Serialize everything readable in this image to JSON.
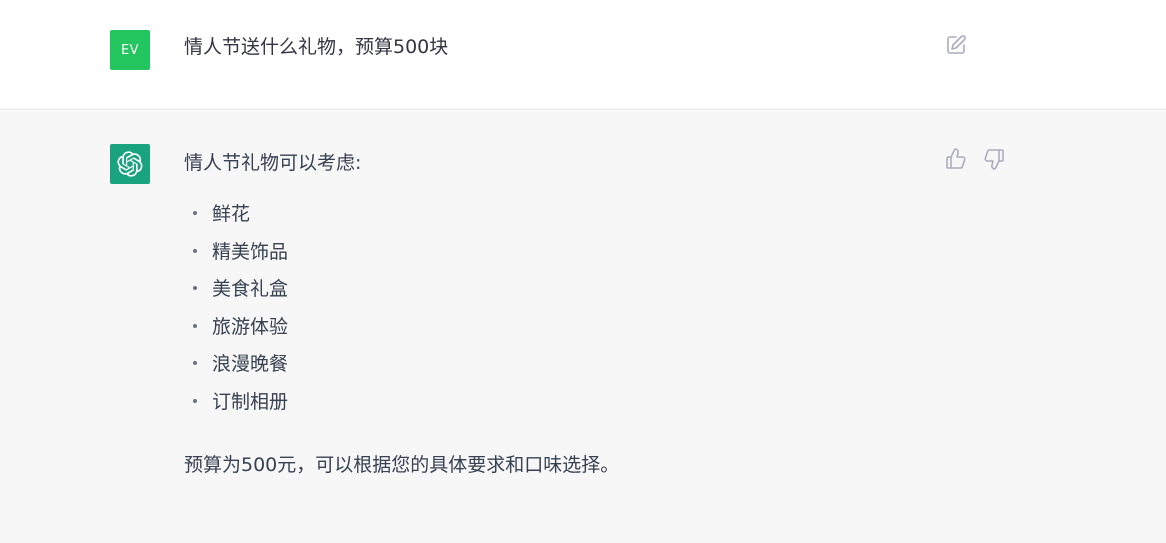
{
  "user_message": {
    "avatar_initials": "EV",
    "avatar_color": "#22c55e",
    "text": "情人节送什么礼物，预算500块",
    "edit_icon": "edit-icon"
  },
  "assistant_message": {
    "avatar_color": "#19a37f",
    "avatar_icon": "openai-logo-icon",
    "intro": "情人节礼物可以考虑:",
    "items": [
      {
        "label": "鲜花"
      },
      {
        "label": "精美饰品"
      },
      {
        "label": "美食礼盒"
      },
      {
        "label": "旅游体验"
      },
      {
        "label": "浪漫晚餐"
      },
      {
        "label": "订制相册"
      }
    ],
    "summary": "预算为500元，可以根据您的具体要求和口味选择。",
    "feedback_icons": [
      "thumbs-up-icon",
      "thumbs-down-icon"
    ]
  }
}
